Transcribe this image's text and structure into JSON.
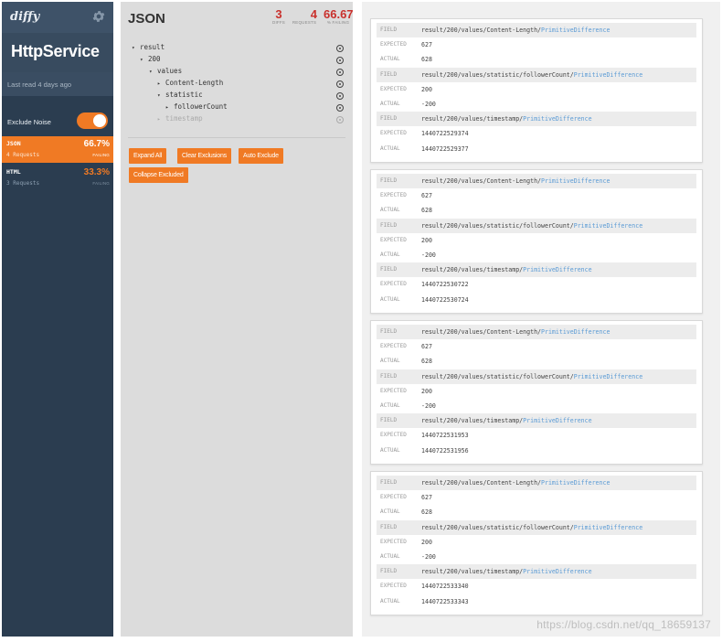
{
  "app": {
    "logo": "diffy",
    "service_name": "HttpService",
    "last_read": "Last read 4 days ago",
    "exclude_noise_label": "Exclude Noise",
    "exclude_noise_on": true,
    "accent_color": "#f07a24"
  },
  "requests": [
    {
      "name": "JSON",
      "count": "4 Requests",
      "percent": "66.7%",
      "status": "FAILING",
      "active": true
    },
    {
      "name": "HTML",
      "count": "3 Requests",
      "percent": "33.3%",
      "status": "FAILING",
      "active": false
    }
  ],
  "panel": {
    "title": "JSON",
    "stats": [
      {
        "value": "3",
        "label": "DIFFS"
      },
      {
        "value": "4",
        "label": "REQUESTS"
      },
      {
        "value": "66.67",
        "label": "% FAILING"
      }
    ],
    "tree": [
      {
        "label": "result",
        "caret": "▾",
        "depth": 0,
        "muted": false
      },
      {
        "label": "200",
        "caret": "▾",
        "depth": 1,
        "muted": false
      },
      {
        "label": "values",
        "caret": "▾",
        "depth": 2,
        "muted": false
      },
      {
        "label": "Content-Length",
        "caret": "▸",
        "depth": 3,
        "muted": false
      },
      {
        "label": "statistic",
        "caret": "▾",
        "depth": 3,
        "muted": false
      },
      {
        "label": "followerCount",
        "caret": "▸",
        "depth": 4,
        "muted": false
      },
      {
        "label": "timestamp",
        "caret": "▸",
        "depth": 3,
        "muted": true
      }
    ],
    "buttons": {
      "expand_all": "Expand All",
      "clear_exclusions": "Clear Exclusions",
      "auto_exclude": "Auto Exclude",
      "collapse_excluded": "Collapse Excluded"
    }
  },
  "labels": {
    "field": "FIELD",
    "expected": "EXPECTED",
    "actual": "ACTUAL"
  },
  "diff_cards": [
    {
      "diffs": [
        {
          "path": "result/200/values/Content-Length/",
          "type": "PrimitiveDifference",
          "expected": "627",
          "actual": "628"
        },
        {
          "path": "result/200/values/statistic/followerCount/",
          "type": "PrimitiveDifference",
          "expected": "200",
          "actual": "-200"
        },
        {
          "path": "result/200/values/timestamp/",
          "type": "PrimitiveDifference",
          "expected": "1440722529374",
          "actual": "1440722529377"
        }
      ]
    },
    {
      "diffs": [
        {
          "path": "result/200/values/Content-Length/",
          "type": "PrimitiveDifference",
          "expected": "627",
          "actual": "628"
        },
        {
          "path": "result/200/values/statistic/followerCount/",
          "type": "PrimitiveDifference",
          "expected": "200",
          "actual": "-200"
        },
        {
          "path": "result/200/values/timestamp/",
          "type": "PrimitiveDifference",
          "expected": "1440722530722",
          "actual": "1440722530724"
        }
      ]
    },
    {
      "diffs": [
        {
          "path": "result/200/values/Content-Length/",
          "type": "PrimitiveDifference",
          "expected": "627",
          "actual": "628"
        },
        {
          "path": "result/200/values/statistic/followerCount/",
          "type": "PrimitiveDifference",
          "expected": "200",
          "actual": "-200"
        },
        {
          "path": "result/200/values/timestamp/",
          "type": "PrimitiveDifference",
          "expected": "1440722531953",
          "actual": "1440722531956"
        }
      ]
    },
    {
      "diffs": [
        {
          "path": "result/200/values/Content-Length/",
          "type": "PrimitiveDifference",
          "expected": "627",
          "actual": "628"
        },
        {
          "path": "result/200/values/statistic/followerCount/",
          "type": "PrimitiveDifference",
          "expected": "200",
          "actual": "-200"
        },
        {
          "path": "result/200/values/timestamp/",
          "type": "PrimitiveDifference",
          "expected": "1440722533340",
          "actual": "1440722533343"
        }
      ]
    }
  ],
  "watermark": "https://blog.csdn.net/qq_18659137"
}
